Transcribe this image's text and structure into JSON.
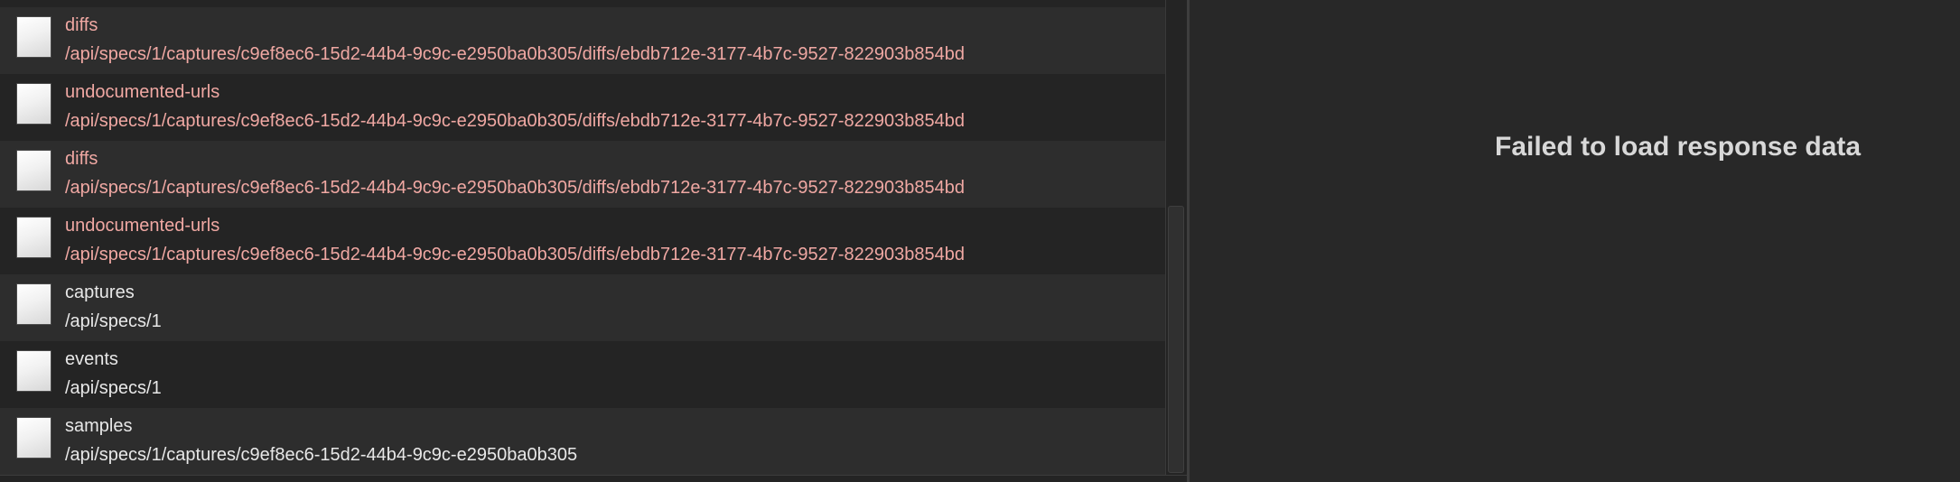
{
  "requests": [
    {
      "name": "diffs",
      "path": "/api/specs/1/captures/c9ef8ec6-15d2-44b4-9c9c-e2950ba0b305/diffs/ebdb712e-3177-4b7c-9527-822903b854bd",
      "status": "error"
    },
    {
      "name": "undocumented-urls",
      "path": "/api/specs/1/captures/c9ef8ec6-15d2-44b4-9c9c-e2950ba0b305/diffs/ebdb712e-3177-4b7c-9527-822903b854bd",
      "status": "error"
    },
    {
      "name": "diffs",
      "path": "/api/specs/1/captures/c9ef8ec6-15d2-44b4-9c9c-e2950ba0b305/diffs/ebdb712e-3177-4b7c-9527-822903b854bd",
      "status": "error"
    },
    {
      "name": "undocumented-urls",
      "path": "/api/specs/1/captures/c9ef8ec6-15d2-44b4-9c9c-e2950ba0b305/diffs/ebdb712e-3177-4b7c-9527-822903b854bd",
      "status": "error"
    },
    {
      "name": "captures",
      "path": "/api/specs/1",
      "status": "ok"
    },
    {
      "name": "events",
      "path": "/api/specs/1",
      "status": "ok"
    },
    {
      "name": "samples",
      "path": "/api/specs/1/captures/c9ef8ec6-15d2-44b4-9c9c-e2950ba0b305",
      "status": "ok"
    }
  ],
  "response_panel": {
    "message": "Failed to load response data"
  },
  "colors": {
    "error_text": "#f0a8a3",
    "normal_text": "#e8e8e8"
  }
}
